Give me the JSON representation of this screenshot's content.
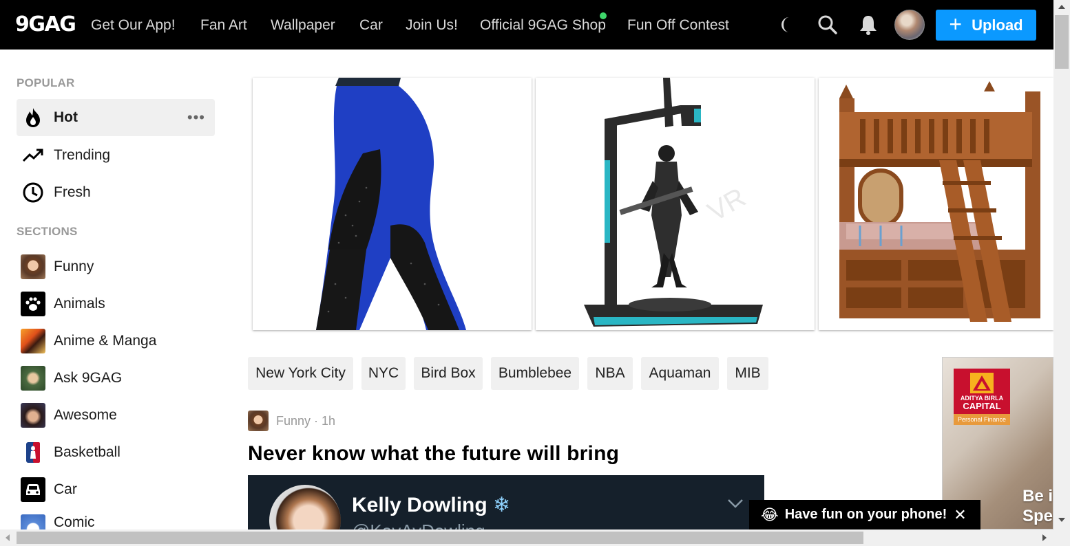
{
  "header": {
    "logo": "9GAG",
    "nav": [
      "Get Our App!",
      "Fan Art",
      "Wallpaper",
      "Car",
      "Join Us!",
      "Official 9GAG Shop",
      "Fun Off Contest"
    ],
    "upload_label": "Upload",
    "icons": [
      "moon-icon",
      "search-icon",
      "bell-icon"
    ],
    "accent_color": "#0b99ff"
  },
  "sidebar": {
    "popular_heading": "POPULAR",
    "popular": [
      {
        "label": "Hot",
        "icon": "fire-icon",
        "active": true
      },
      {
        "label": "Trending",
        "icon": "trending-icon"
      },
      {
        "label": "Fresh",
        "icon": "clock-icon"
      }
    ],
    "sections_heading": "SECTIONS",
    "sections": [
      {
        "label": "Funny"
      },
      {
        "label": "Animals"
      },
      {
        "label": "Anime & Manga"
      },
      {
        "label": "Ask 9GAG"
      },
      {
        "label": "Awesome"
      },
      {
        "label": "Basketball"
      },
      {
        "label": "Car"
      },
      {
        "label": "Comic"
      }
    ]
  },
  "featured": [
    "leggings-product",
    "vr-treadmill-product",
    "bunk-bed-product"
  ],
  "tags": [
    "New York City",
    "NYC",
    "Bird Box",
    "Bumblebee",
    "NBA",
    "Aquaman",
    "MIB"
  ],
  "post": {
    "section": "Funny",
    "time": "1h",
    "meta": "Funny · 1h",
    "title": "Never know what the future will bring",
    "tweet_name": "Kelly Dowling",
    "tweet_handle": "@KayAyDowling"
  },
  "ad": {
    "brand_line1": "ADITYA BIRLA",
    "brand_line2": "CAPITAL",
    "brand_line3": "Personal Finance",
    "text_line1": "Be i",
    "text_line2": "Spe"
  },
  "promo": {
    "emoji": "😂",
    "text": "Have fun on your phone!",
    "close": "✕"
  }
}
